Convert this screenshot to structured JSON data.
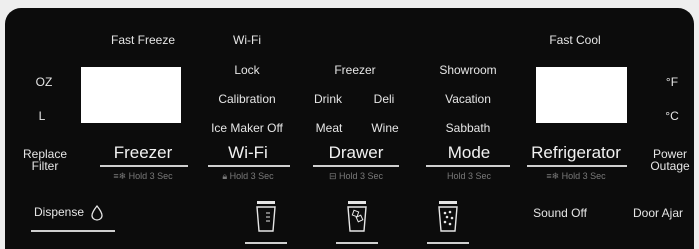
{
  "top": {
    "fast_freeze": "Fast Freeze",
    "wifi": "Wi-Fi",
    "fast_cool": "Fast Cool"
  },
  "left": {
    "oz": "OZ",
    "l": "L",
    "replace_line1": "Replace",
    "replace_line2": "Filter",
    "dispense": "Dispense"
  },
  "right": {
    "f": "°F",
    "c": "°C",
    "power_line1": "Power",
    "power_line2": "Outage"
  },
  "options": {
    "lock": "Lock",
    "calibration": "Calibration",
    "ice_maker_off": "Ice Maker Off",
    "freezer": "Freezer",
    "drink": "Drink",
    "deli": "Deli",
    "meat": "Meat",
    "wine": "Wine",
    "showroom": "Showroom",
    "vacation": "Vacation",
    "sabbath": "Sabbath"
  },
  "buttons": {
    "freezer": "Freezer",
    "wifi": "Wi-Fi",
    "drawer": "Drawer",
    "mode": "Mode",
    "refrigerator": "Refrigerator"
  },
  "holds": {
    "freezer": "Hold 3 Sec",
    "wifi": "Hold 3 Sec",
    "drawer": "Hold 3 Sec",
    "mode": "Hold 3 Sec",
    "refrigerator": "Hold 3 Sec"
  },
  "bottom": {
    "sound_off": "Sound Off",
    "door_ajar": "Door Ajar"
  },
  "colors": {
    "panel": "#0c0c0c",
    "text": "#e6e6e6",
    "hold": "#7a7a7a",
    "display": "#ffffff"
  }
}
